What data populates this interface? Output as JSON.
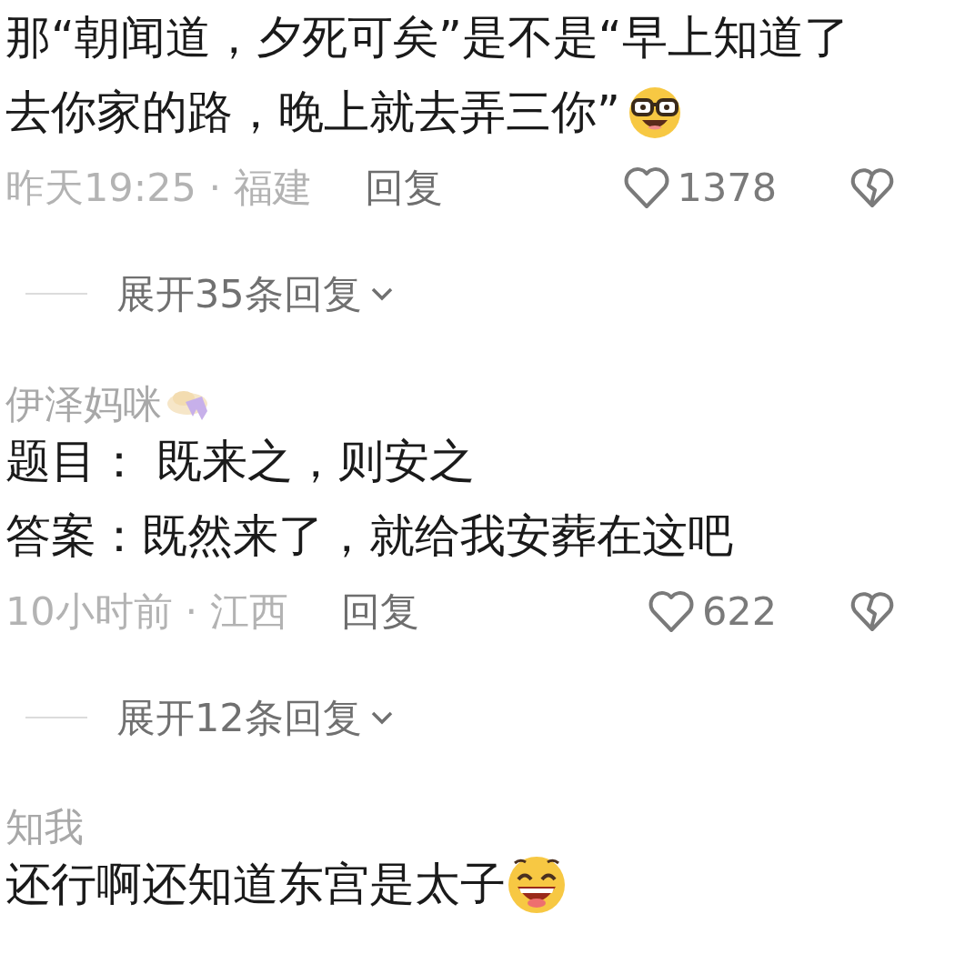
{
  "comments": [
    {
      "lines": [
        "那“朝闻道，夕死可矣”是不是“早上知道了",
        "去你家的路，晚上就去弄三你”"
      ],
      "emoji": true,
      "meta": "昨天19:25 · 福建",
      "reply": "回复",
      "likes": "1378",
      "expand": "展开35条回复"
    },
    {
      "username": "伊泽妈咪",
      "badge": true,
      "lines": [
        "题目： 既来之，则安之",
        "答案：既然来了，就给我安葬在这吧"
      ],
      "meta": "10小时前 · 江西",
      "reply": "回复",
      "likes": "622",
      "expand": "展开12条回复"
    },
    {
      "username": "知我",
      "lines": [
        "还行啊还知道东宫是太子"
      ],
      "emoji": true
    }
  ]
}
